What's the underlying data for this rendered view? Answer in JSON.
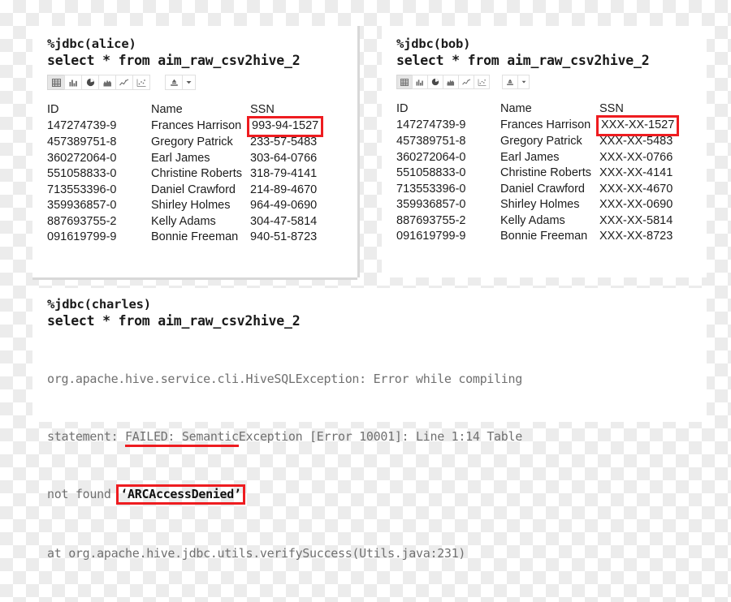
{
  "panels": {
    "alice": {
      "interpreter": "%jdbc(alice)",
      "query": "select * from aim_raw_csv2hive_2",
      "toolbar": {
        "buttons": [
          {
            "name": "table-view",
            "icon": "table-icon",
            "active": true
          },
          {
            "name": "bar-chart-view",
            "icon": "bar-chart-icon",
            "active": false
          },
          {
            "name": "pie-chart-view",
            "icon": "pie-chart-icon",
            "active": false
          },
          {
            "name": "area-chart-view",
            "icon": "area-chart-icon",
            "active": false
          },
          {
            "name": "line-chart-view",
            "icon": "line-chart-icon",
            "active": false
          },
          {
            "name": "scatter-chart-view",
            "icon": "scatter-chart-icon",
            "active": false
          }
        ],
        "export": {
          "name": "export-button",
          "icon": "download-icon"
        },
        "export_caret": {
          "name": "export-dropdown-caret",
          "icon": "caret-down-icon"
        }
      },
      "table": {
        "columns": [
          "ID",
          "Name",
          "SSN"
        ],
        "rows": [
          [
            "147274739-9",
            "Frances Harrison",
            "993-94-1527"
          ],
          [
            "457389751-8",
            "Gregory Patrick",
            "233-57-5483"
          ],
          [
            "360272064-0",
            "Earl James",
            "303-64-0766"
          ],
          [
            "551058833-0",
            "Christine Roberts",
            "318-79-4141"
          ],
          [
            "713553396-0",
            "Daniel Crawford",
            "214-89-4670"
          ],
          [
            "359936857-0",
            "Shirley Holmes",
            "964-49-0690"
          ],
          [
            "887693755-2",
            "Kelly Adams",
            "304-47-5814"
          ],
          [
            "091619799-9",
            "Bonnie Freeman",
            "940-51-8723"
          ]
        ],
        "highlighted_cell": {
          "row": 0,
          "column": 2
        }
      }
    },
    "bob": {
      "interpreter": "%jdbc(bob)",
      "query": "select * from aim_raw_csv2hive_2",
      "toolbar": {
        "buttons": [
          {
            "name": "table-view",
            "icon": "table-icon",
            "active": true
          },
          {
            "name": "bar-chart-view",
            "icon": "bar-chart-icon",
            "active": false
          },
          {
            "name": "pie-chart-view",
            "icon": "pie-chart-icon",
            "active": false
          },
          {
            "name": "area-chart-view",
            "icon": "area-chart-icon",
            "active": false
          },
          {
            "name": "line-chart-view",
            "icon": "line-chart-icon",
            "active": false
          },
          {
            "name": "scatter-chart-view",
            "icon": "scatter-chart-icon",
            "active": false
          }
        ],
        "export": {
          "name": "export-button",
          "icon": "download-icon"
        },
        "export_caret": {
          "name": "export-dropdown-caret",
          "icon": "caret-down-icon"
        }
      },
      "table": {
        "columns": [
          "ID",
          "Name",
          "SSN"
        ],
        "rows": [
          [
            "147274739-9",
            "Frances Harrison",
            "XXX-XX-1527"
          ],
          [
            "457389751-8",
            "Gregory Patrick",
            "XXX-XX-5483"
          ],
          [
            "360272064-0",
            "Earl James",
            "XXX-XX-0766"
          ],
          [
            "551058833-0",
            "Christine Roberts",
            "XXX-XX-4141"
          ],
          [
            "713553396-0",
            "Daniel Crawford",
            "XXX-XX-4670"
          ],
          [
            "359936857-0",
            "Shirley Holmes",
            "XXX-XX-0690"
          ],
          [
            "887693755-2",
            "Kelly Adams",
            "XXX-XX-5814"
          ],
          [
            "091619799-9",
            "Bonnie Freeman",
            "XXX-XX-8723"
          ]
        ],
        "highlighted_cell": {
          "row": 0,
          "column": 2
        }
      }
    },
    "charles": {
      "interpreter": "%jdbc(charles)",
      "query": "select * from aim_raw_csv2hive_2",
      "error": {
        "line1_plain": "org.apache.hive.service.cli.HiveSQLException: Error while compiling",
        "line2_pre": "statement: ",
        "line2_underlined": "FAILED: Semantic",
        "line2_post": "Exception [Error 10001]: Line 1:14 Table",
        "line3_pre": "not found ",
        "line3_boxed": "‘ARCAccessDenied’",
        "line4": "at org.apache.hive.jdbc.utils.verifySuccess(Utils.java:231)"
      }
    }
  },
  "colors": {
    "highlight_red": "#ee1c20",
    "panel_background": "#ffffff",
    "error_text": "#707070",
    "code_text": "#1a1a1a",
    "toolbar_active": "#e6e6e6"
  }
}
